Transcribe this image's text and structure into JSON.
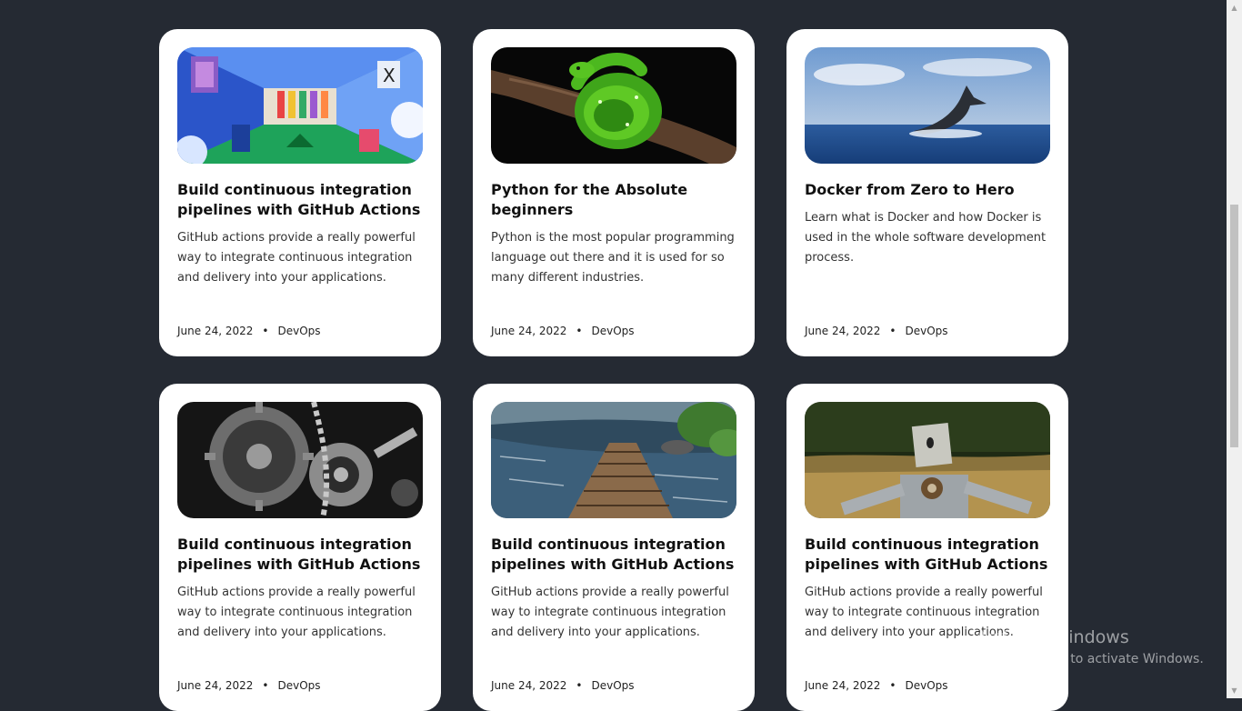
{
  "cards": [
    {
      "image": "abstract-corridor-illustration",
      "title": "Build continuous integration pipelines with GitHub Actions",
      "description": "GitHub actions provide a really powerful way to integrate continuous integration and delivery into your applications.",
      "date": "June 24, 2022",
      "separator": "•",
      "category": "DevOps"
    },
    {
      "image": "green-python-snake",
      "title": "Python for the Absolute beginners",
      "description": "Python is the most popular programming language out there and it is used for so many different industries.",
      "date": "June 24, 2022",
      "separator": "•",
      "category": "DevOps"
    },
    {
      "image": "whale-tail-ocean",
      "title": "Docker from Zero to Hero",
      "description": "Learn what is Docker and how Docker is used in the whole software development process.",
      "date": "June 24, 2022",
      "separator": "•",
      "category": "DevOps"
    },
    {
      "image": "metal-gears-chain",
      "title": "Build continuous integration pipelines with GitHub Actions",
      "description": "GitHub actions provide a really powerful way to integrate continuous integration and delivery into your applications.",
      "date": "June 24, 2022",
      "separator": "•",
      "category": "DevOps"
    },
    {
      "image": "wooden-bridge-stream",
      "title": "Build continuous integration pipelines with GitHub Actions",
      "description": "GitHub actions provide a really powerful way to integrate continuous integration and delivery into your applications.",
      "date": "June 24, 2022",
      "separator": "•",
      "category": "DevOps"
    },
    {
      "image": "tin-robot-field",
      "title": "Build continuous integration pipelines with GitHub Actions",
      "description": "GitHub actions provide a really powerful way to integrate continuous integration and delivery into your applications.",
      "date": "June 24, 2022",
      "separator": "•",
      "category": "DevOps"
    }
  ],
  "watermark": {
    "line1": "Activate Windows",
    "line2": "Go to Settings to activate Windows."
  },
  "colors": {
    "background": "#252a33",
    "card": "#ffffff"
  }
}
